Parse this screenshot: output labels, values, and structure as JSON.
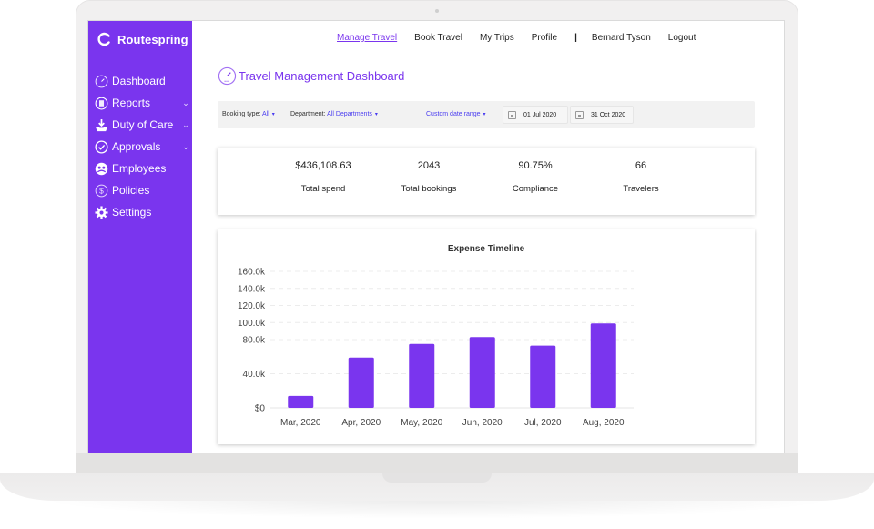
{
  "app": {
    "brand_name": "Routespring",
    "accent_color": "#7a35ee"
  },
  "sidebar": {
    "items": [
      {
        "label": "Dashboard",
        "icon": "dashboard-gauge-icon",
        "has_chevron": false
      },
      {
        "label": "Reports",
        "icon": "reports-icon",
        "has_chevron": true
      },
      {
        "label": "Duty of Care",
        "icon": "duty-of-care-icon",
        "has_chevron": true
      },
      {
        "label": "Approvals",
        "icon": "approvals-check-icon",
        "has_chevron": true
      },
      {
        "label": "Employees",
        "icon": "employees-icon",
        "has_chevron": false
      },
      {
        "label": "Policies",
        "icon": "policies-dollar-icon",
        "has_chevron": false
      },
      {
        "label": "Settings",
        "icon": "settings-gear-icon",
        "has_chevron": false
      }
    ],
    "chevron": "⌄"
  },
  "topnav": {
    "items": [
      {
        "label": "Manage Travel",
        "active": true
      },
      {
        "label": "Book Travel",
        "active": false
      },
      {
        "label": "My Trips",
        "active": false
      },
      {
        "label": "Profile",
        "active": false
      }
    ],
    "separator": "|",
    "user_name": "Bernard Tyson",
    "logout_label": "Logout"
  },
  "page": {
    "title": "Travel Management Dashboard"
  },
  "filters": {
    "booking_type_label": "Booking type:",
    "booking_type_value": "All",
    "department_label": "Department:",
    "department_value": "All Departments",
    "date_range_value": "Custom date range",
    "caret": "▾",
    "start_date": "01 Jul 2020",
    "end_date": "31 Oct 2020"
  },
  "kpis": [
    {
      "value": "$436,108.63",
      "label": "Total spend"
    },
    {
      "value": "2043",
      "label": "Total bookings"
    },
    {
      "value": "90.75%",
      "label": "Compliance"
    },
    {
      "value": "66",
      "label": "Travelers"
    }
  ],
  "chart_data": {
    "type": "bar",
    "title": "Expense Timeline",
    "xlabel": "",
    "ylabel": "",
    "categories": [
      "Mar, 2020",
      "Apr, 2020",
      "May, 2020",
      "Jun, 2020",
      "Jul, 2020",
      "Aug, 2020"
    ],
    "values": [
      14000,
      59000,
      75000,
      83000,
      73000,
      99000
    ],
    "ylim": [
      0,
      160000
    ],
    "yticks": [
      0,
      40000,
      80000,
      100000,
      120000,
      140000,
      160000
    ],
    "ytick_labels": [
      "$0",
      "40.0k",
      "80.0k",
      "100.0k",
      "120.0k",
      "140.0k",
      "160.0k"
    ],
    "grid": true,
    "bar_color": "#7a35ee"
  }
}
